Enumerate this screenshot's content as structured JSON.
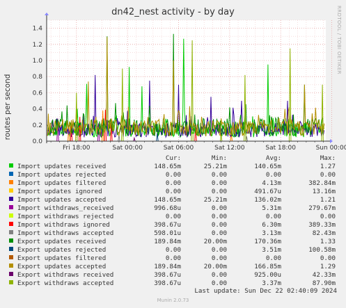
{
  "chart_data": {
    "type": "line",
    "title": "dn42_nest activity - by day",
    "ylabel": "routes per second",
    "xlabel": "",
    "ylim": [
      0,
      1.5
    ],
    "yticks": [
      "0.0",
      "0.2",
      "0.4",
      "0.6",
      "0.8",
      "1.0",
      "1.2",
      "1.4"
    ],
    "xticks": [
      "Fri 18:00",
      "Sat 00:00",
      "Sat 06:00",
      "Sat 12:00",
      "Sat 18:00",
      "Sun 00:00"
    ],
    "x_range_hours": [
      -3.5,
      29.3
    ],
    "grid": true,
    "legend_position": "bottom",
    "columns": [
      "Cur:",
      "Min:",
      "Avg:",
      "Max:"
    ],
    "series": [
      {
        "name": "Import updates received",
        "color": "#00cc00",
        "cur": "148.65m",
        "min": "25.21m",
        "avg": "140.65m",
        "max": "1.27",
        "spikes": [
          [
            6.2,
            0.92
          ],
          [
            12.6,
            1.27
          ],
          [
            22.5,
            0.95
          ],
          [
            7.7,
            0.68
          ],
          [
            1.2,
            0.71
          ]
        ]
      },
      {
        "name": "Import updates rejected",
        "color": "#0066b3",
        "cur": "0.00",
        "min": "0.00",
        "avg": "0.00",
        "max": "0.00",
        "spikes": []
      },
      {
        "name": "Import updates filtered",
        "color": "#ff8000",
        "cur": "0.00",
        "min": "0.00",
        "avg": "4.13m",
        "max": "382.84m",
        "spikes": [
          [
            3.1,
            0.38
          ],
          [
            -0.9,
            0.2
          ],
          [
            18.2,
            0.1
          ]
        ]
      },
      {
        "name": "Import updates ignored",
        "color": "#ffcc00",
        "cur": "0.00",
        "min": "0.00",
        "avg": "491.67u",
        "max": "13.16m",
        "spikes": []
      },
      {
        "name": "Import updates accepted",
        "color": "#330099",
        "cur": "148.65m",
        "min": "25.21m",
        "avg": "136.02m",
        "max": "1.21",
        "spikes": [
          [
            2.2,
            0.82
          ],
          [
            8.6,
            0.75
          ],
          [
            12.0,
            0.7
          ],
          [
            15.8,
            0.55
          ],
          [
            19.4,
            0.5
          ],
          [
            24.8,
            0.5
          ]
        ]
      },
      {
        "name": "Import withdraws_received",
        "color": "#990099",
        "cur": "996.68u",
        "min": "0.00",
        "avg": "5.31m",
        "max": "279.67m",
        "spikes": [
          [
            -2.2,
            0.28
          ],
          [
            2.6,
            0.22
          ]
        ]
      },
      {
        "name": "Import withdraws rejected",
        "color": "#ccff00",
        "cur": "0.00",
        "min": "0.00",
        "avg": "0.00",
        "max": "0.00",
        "spikes": []
      },
      {
        "name": "Import withdraws ignored",
        "color": "#ff0000",
        "cur": "398.67u",
        "min": "0.00",
        "avg": "6.30m",
        "max": "389.33m",
        "spikes": [
          [
            0.4,
            0.3
          ],
          [
            3.4,
            0.39
          ],
          [
            4.1,
            0.26
          ],
          [
            14.0,
            0.2
          ],
          [
            -0.6,
            0.19
          ]
        ]
      },
      {
        "name": "Import withdraws accepted",
        "color": "#808080",
        "cur": "598.01u",
        "min": "0.00",
        "avg": "3.13m",
        "max": "82.43m",
        "spikes": [
          [
            5.0,
            0.08
          ],
          [
            20.0,
            0.06
          ]
        ]
      },
      {
        "name": "Export updates received",
        "color": "#008f00",
        "cur": "189.84m",
        "min": "20.00m",
        "avg": "170.36m",
        "max": "1.33",
        "spikes": [
          [
            11.4,
            1.33
          ],
          [
            3.6,
            1.3
          ],
          [
            26.8,
            0.7
          ]
        ]
      },
      {
        "name": "Export updates rejected",
        "color": "#00487d",
        "cur": "0.00",
        "min": "0.00",
        "avg": "3.51m",
        "max": "100.58m",
        "spikes": [
          [
            9.5,
            0.1
          ]
        ]
      },
      {
        "name": "Export updates filtered",
        "color": "#b35a00",
        "cur": "0.00",
        "min": "0.00",
        "avg": "0.00",
        "max": "0.00",
        "spikes": []
      },
      {
        "name": "Export updates accepted",
        "color": "#b38f00",
        "cur": "189.84m",
        "min": "20.00m",
        "avg": "166.85m",
        "max": "1.29",
        "spikes": [
          [
            3.6,
            1.29
          ],
          [
            11.4,
            1.0
          ],
          [
            26.8,
            0.7
          ],
          [
            1.4,
            0.74
          ]
        ]
      },
      {
        "name": "Export withdraws received",
        "color": "#6b006b",
        "cur": "398.67u",
        "min": "0.00",
        "avg": "925.00u",
        "max": "42.33m",
        "spikes": [
          [
            6.8,
            0.04
          ]
        ]
      },
      {
        "name": "Export withdraws accepted",
        "color": "#8fb300",
        "cur": "398.67u",
        "min": "0.00",
        "avg": "3.37m",
        "max": "87.90m",
        "spikes": [
          [
            17.0,
            0.08
          ],
          [
            0.0,
            0.6
          ],
          [
            5.4,
            0.9
          ],
          [
            13.6,
            1.25
          ],
          [
            19.8,
            0.82
          ],
          [
            25.1,
            1.15
          ],
          [
            28.9,
            0.7
          ]
        ]
      }
    ]
  },
  "last_update": "Last update:  Sun Dec 22 02:40:09 2024",
  "watermark": "RRDTOOL / TOBI OETIKER",
  "footer": "Munin 2.0.73"
}
